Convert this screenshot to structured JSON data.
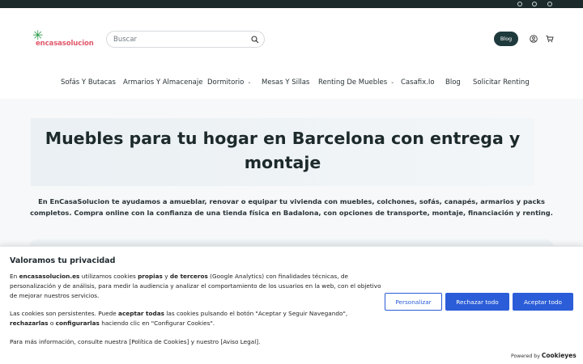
{
  "topbar": {
    "social_icons": [
      "facebook-icon",
      "instagram-icon",
      "whatsapp-icon"
    ],
    "color": "#1d2a2c"
  },
  "header": {
    "logo_text": "encasasolucion",
    "logo_color": "#e0576a",
    "search_placeholder": "Buscar",
    "blog_button": "Blog",
    "icons": [
      "search-icon",
      "user-icon",
      "cart-icon"
    ]
  },
  "nav": {
    "items": [
      {
        "label": "Sofás Y Butacas",
        "has_dropdown": false
      },
      {
        "label": "Armarios Y Almacenaje",
        "has_dropdown": false
      },
      {
        "label": "Dormitorio",
        "has_dropdown": true
      },
      {
        "label": "Mesas Y Sillas",
        "has_dropdown": false
      },
      {
        "label": "Renting De Muebles",
        "has_dropdown": true
      },
      {
        "label": "Casafix.Io",
        "has_dropdown": false
      },
      {
        "label": "Blog",
        "has_dropdown": false
      },
      {
        "label": "Solicitar Renting",
        "has_dropdown": false
      }
    ]
  },
  "hero": {
    "title_line1": "Muebles para tu hogar en Barcelona con entrega y",
    "title_line2": "montaje"
  },
  "intro": {
    "line1": "En EnCasaSolucion te ayudamos a amueblar, renovar o equipar tu vivienda con muebles, colchones, sofás, canapés, armarios y packs",
    "line2": "completos. Compra online con la confianza de una tienda física en Badalona, con opciones de transporte, montaje, financiación y renting."
  },
  "cookie_banner": {
    "title": "Valoramos tu privacidad",
    "p1_a": "En ",
    "p1_site": "encasasolucion.es",
    "p1_b": " utilizamos cookies ",
    "p1_own": "propias",
    "p1_c": " y ",
    "p1_third": "de terceros",
    "p1_d": " (Google Analytics) con finalidades técnicas, de personalización y de análisis, para medir la audiencia y analizar el comportamiento de los usuarios en la web, con el objetivo de mejorar nuestros servicios.",
    "p2_a": "Las cookies son persistentes. Puede ",
    "p2_accept": "aceptar todas",
    "p2_b": " las cookies pulsando el botón \"Aceptar y Seguir Navegando\", ",
    "p2_reject": "rechazarlas",
    "p2_c": " o ",
    "p2_config": "configurarlas",
    "p2_d": " haciendo clic en \"Configurar Cookies\".",
    "p3": "Para más información, consulte nuestra [Política de Cookies] y nuestro [Aviso Legal].",
    "btn_customize": "Personalizar",
    "btn_reject": "Rechazar todo",
    "btn_accept": "Aceptar todo",
    "powered_by": "Powered by",
    "powered_brand": "Cookieyes",
    "accent_color": "#2b5dd8"
  }
}
